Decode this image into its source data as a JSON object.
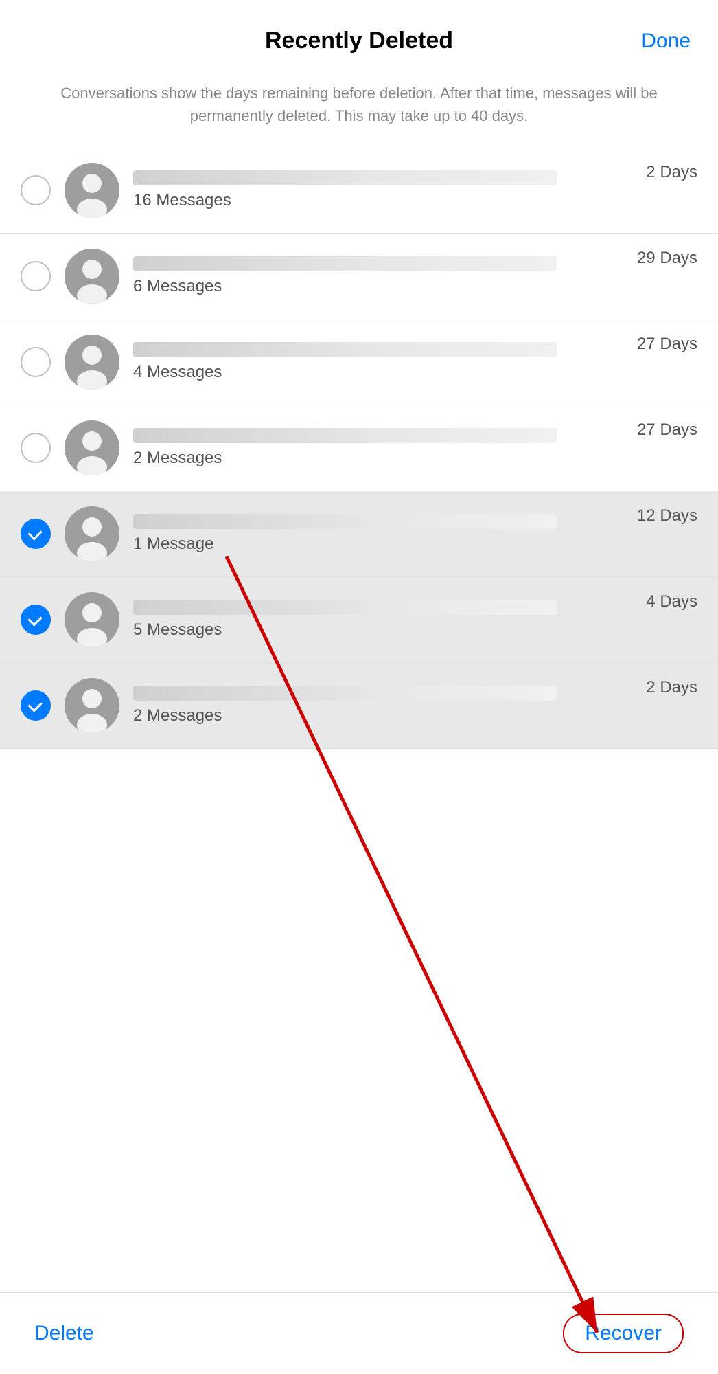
{
  "header": {
    "title": "Recently Deleted",
    "done_label": "Done"
  },
  "subtitle": "Conversations show the days remaining before deletion. After that time, messages will be permanently deleted. This may take up to 40 days.",
  "items": [
    {
      "id": 1,
      "messages": "16 Messages",
      "days": "2 Days",
      "selected": false
    },
    {
      "id": 2,
      "messages": "6 Messages",
      "days": "29 Days",
      "selected": false
    },
    {
      "id": 3,
      "messages": "4 Messages",
      "days": "27 Days",
      "selected": false
    },
    {
      "id": 4,
      "messages": "2 Messages",
      "days": "27 Days",
      "selected": false
    },
    {
      "id": 5,
      "messages": "1 Message",
      "days": "12 Days",
      "selected": true
    },
    {
      "id": 6,
      "messages": "5 Messages",
      "days": "4 Days",
      "selected": true
    },
    {
      "id": 7,
      "messages": "2 Messages",
      "days": "2 Days",
      "selected": true
    }
  ],
  "toolbar": {
    "delete_label": "Delete",
    "recover_label": "Recover"
  }
}
